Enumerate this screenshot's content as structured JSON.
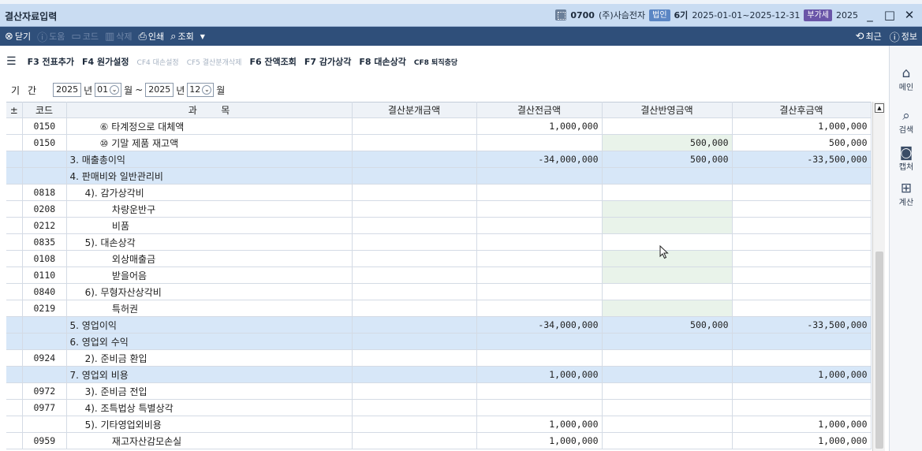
{
  "titlebar": {
    "app_title": "결산자료입력",
    "company_code": "0700",
    "company_name": "(주)사슴전자",
    "badge_corp": "법인",
    "period_label": "6기",
    "period_range": "2025-01-01~2025-12-31",
    "badge_vat": "부가세",
    "vat_year": "2025",
    "minimize": "_",
    "maximize": "□",
    "close": "✕"
  },
  "toolbar": {
    "close_label": "닫기",
    "help_label": "도움",
    "code_label": "코드",
    "delete_label": "삭제",
    "print_label": "인쇄",
    "search_label": "조회",
    "recent_label": "최근",
    "info_label": "정보"
  },
  "fkeys": {
    "f3": "F3 전표추가",
    "f4": "F4 원가설정",
    "cf4": "CF4 대손설정",
    "cf5": "CF5 결산분개삭제",
    "f6": "F6 잔액조회",
    "f7": "F7 감가상각",
    "f8": "F8 대손상각",
    "cf8": "CF8 퇴직충당"
  },
  "period": {
    "label": "기간",
    "start_year": "2025",
    "year_unit": "년",
    "start_month": "01",
    "month_unit": "월",
    "tilde": "~",
    "end_year": "2025",
    "end_month": "12"
  },
  "table": {
    "headers": [
      "±",
      "코드",
      "과        목",
      "결산분개금액",
      "결산전금액",
      "결산반영금액",
      "결산후금액"
    ],
    "rows": [
      {
        "code": "0150",
        "subject": "          ⑥ 타계정으로 대체액",
        "journal": "",
        "before": "1,000,000",
        "reflect": "",
        "after": "1,000,000",
        "section": false,
        "editable": false
      },
      {
        "code": "0150",
        "subject": "          ⑩ 기말 제품 재고액",
        "journal": "",
        "before": "",
        "reflect": "500,000",
        "after": "500,000",
        "section": false,
        "editable": true
      },
      {
        "code": "",
        "subject": "3. 매출총이익",
        "journal": "",
        "before": "-34,000,000",
        "reflect": "500,000",
        "after": "-33,500,000",
        "section": true,
        "editable": false
      },
      {
        "code": "",
        "subject": "4. 판매비와 일반관리비",
        "journal": "",
        "before": "",
        "reflect": "",
        "after": "",
        "section": true,
        "editable": false
      },
      {
        "code": "0818",
        "subject": "     4). 감가상각비",
        "journal": "",
        "before": "",
        "reflect": "",
        "after": "",
        "section": false,
        "editable": false
      },
      {
        "code": "0208",
        "subject": "              차량운반구",
        "journal": "",
        "before": "",
        "reflect": "",
        "after": "",
        "section": false,
        "editable": true
      },
      {
        "code": "0212",
        "subject": "              비품",
        "journal": "",
        "before": "",
        "reflect": "",
        "after": "",
        "section": false,
        "editable": true
      },
      {
        "code": "0835",
        "subject": "     5). 대손상각",
        "journal": "",
        "before": "",
        "reflect": "",
        "after": "",
        "section": false,
        "editable": false
      },
      {
        "code": "0108",
        "subject": "              외상매출금",
        "journal": "",
        "before": "",
        "reflect": "",
        "after": "",
        "section": false,
        "editable": true
      },
      {
        "code": "0110",
        "subject": "              받을어음",
        "journal": "",
        "before": "",
        "reflect": "",
        "after": "",
        "section": false,
        "editable": true
      },
      {
        "code": "0840",
        "subject": "     6). 무형자산상각비",
        "journal": "",
        "before": "",
        "reflect": "",
        "after": "",
        "section": false,
        "editable": false
      },
      {
        "code": "0219",
        "subject": "              특허권",
        "journal": "",
        "before": "",
        "reflect": "",
        "after": "",
        "section": false,
        "editable": true
      },
      {
        "code": "",
        "subject": "5. 영업이익",
        "journal": "",
        "before": "-34,000,000",
        "reflect": "500,000",
        "after": "-33,500,000",
        "section": true,
        "editable": false
      },
      {
        "code": "",
        "subject": "6. 영업외 수익",
        "journal": "",
        "before": "",
        "reflect": "",
        "after": "",
        "section": true,
        "editable": false
      },
      {
        "code": "0924",
        "subject": "     2). 준비금 환입",
        "journal": "",
        "before": "",
        "reflect": "",
        "after": "",
        "section": false,
        "editable": false
      },
      {
        "code": "",
        "subject": "7. 영업외 비용",
        "journal": "",
        "before": "1,000,000",
        "reflect": "",
        "after": "1,000,000",
        "section": true,
        "editable": false
      },
      {
        "code": "0972",
        "subject": "     3). 준비금 전입",
        "journal": "",
        "before": "",
        "reflect": "",
        "after": "",
        "section": false,
        "editable": false
      },
      {
        "code": "0977",
        "subject": "     4). 조특법상 특별상각",
        "journal": "",
        "before": "",
        "reflect": "",
        "after": "",
        "section": false,
        "editable": false
      },
      {
        "code": "",
        "subject": "     5). 기타영업외비용",
        "journal": "",
        "before": "1,000,000",
        "reflect": "",
        "after": "1,000,000",
        "section": false,
        "editable": false
      },
      {
        "code": "0959",
        "subject": "              재고자산감모손실",
        "journal": "",
        "before": "1,000,000",
        "reflect": "",
        "after": "1,000,000",
        "section": false,
        "editable": false
      }
    ]
  },
  "sidepanel": {
    "menu_label": "메인",
    "search_label": "검색",
    "capture_label": "캡처",
    "calc_label": "계산"
  },
  "colors": {
    "titlebar_bg": "#c9dcf2",
    "toolbar_bg": "#2f4f7a",
    "section_row": "#d7e7f8",
    "editable_cell": "#e9f3ea"
  }
}
